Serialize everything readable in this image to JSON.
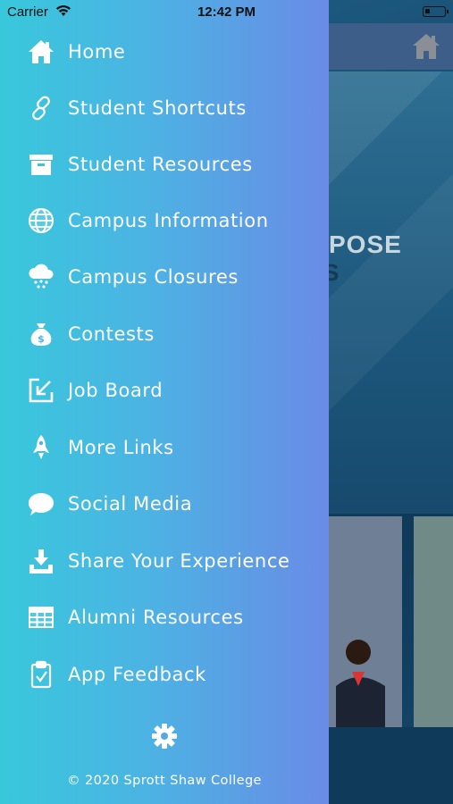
{
  "status_bar": {
    "carrier": "Carrier",
    "time": "12:42 PM"
  },
  "background": {
    "hero_text_line1": "POSE",
    "hero_text_line2": "S"
  },
  "menu": {
    "items": [
      {
        "label": "Home",
        "icon": "home-icon"
      },
      {
        "label": "Student Shortcuts",
        "icon": "link-icon"
      },
      {
        "label": "Student Resources",
        "icon": "archive-box-icon"
      },
      {
        "label": "Campus Information",
        "icon": "globe-icon"
      },
      {
        "label": "Campus Closures",
        "icon": "snow-cloud-icon"
      },
      {
        "label": "Contests",
        "icon": "money-bag-icon"
      },
      {
        "label": "Job Board",
        "icon": "arrow-in-box-icon"
      },
      {
        "label": "More Links",
        "icon": "rocket-icon"
      },
      {
        "label": "Social Media",
        "icon": "speech-bubble-icon"
      },
      {
        "label": "Share Your Experience",
        "icon": "download-tray-icon"
      },
      {
        "label": "Alumni Resources",
        "icon": "table-grid-icon"
      },
      {
        "label": "App Feedback",
        "icon": "clipboard-check-icon"
      }
    ]
  },
  "footer": {
    "settings_icon": "gear-icon",
    "copyright": "© 2020 Sprott Shaw College"
  },
  "colors": {
    "drawer_gradient_start": "#38c8dc",
    "drawer_gradient_end": "#6a8be6",
    "text": "#ffffff"
  }
}
